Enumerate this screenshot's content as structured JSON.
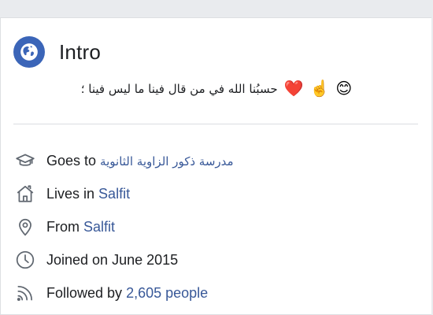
{
  "intro": {
    "title": "Intro",
    "icon": "globe-icon",
    "bio_text": "حسبُنا الله في من قال فينا ما ليس فينا ؛",
    "bio_emojis": [
      "❤️",
      "☝️",
      "😊"
    ]
  },
  "details": [
    {
      "icon": "graduation-cap-icon",
      "prefix": "Goes to ",
      "link": "مدرسة ذكور الزاوية الثانوية",
      "suffix": ""
    },
    {
      "icon": "home-icon",
      "prefix": "Lives in ",
      "link": "Salfit",
      "suffix": ""
    },
    {
      "icon": "location-pin-icon",
      "prefix": "From ",
      "link": "Salfit",
      "suffix": ""
    },
    {
      "icon": "clock-icon",
      "prefix": "Joined on June 2015",
      "link": "",
      "suffix": ""
    },
    {
      "icon": "rss-feed-icon",
      "prefix": "Followed by ",
      "link": "2,605 people",
      "suffix": ""
    }
  ],
  "colors": {
    "accent": "#3b65b8",
    "link": "#385898",
    "text": "#1c1e21",
    "divider": "#dadde1"
  }
}
